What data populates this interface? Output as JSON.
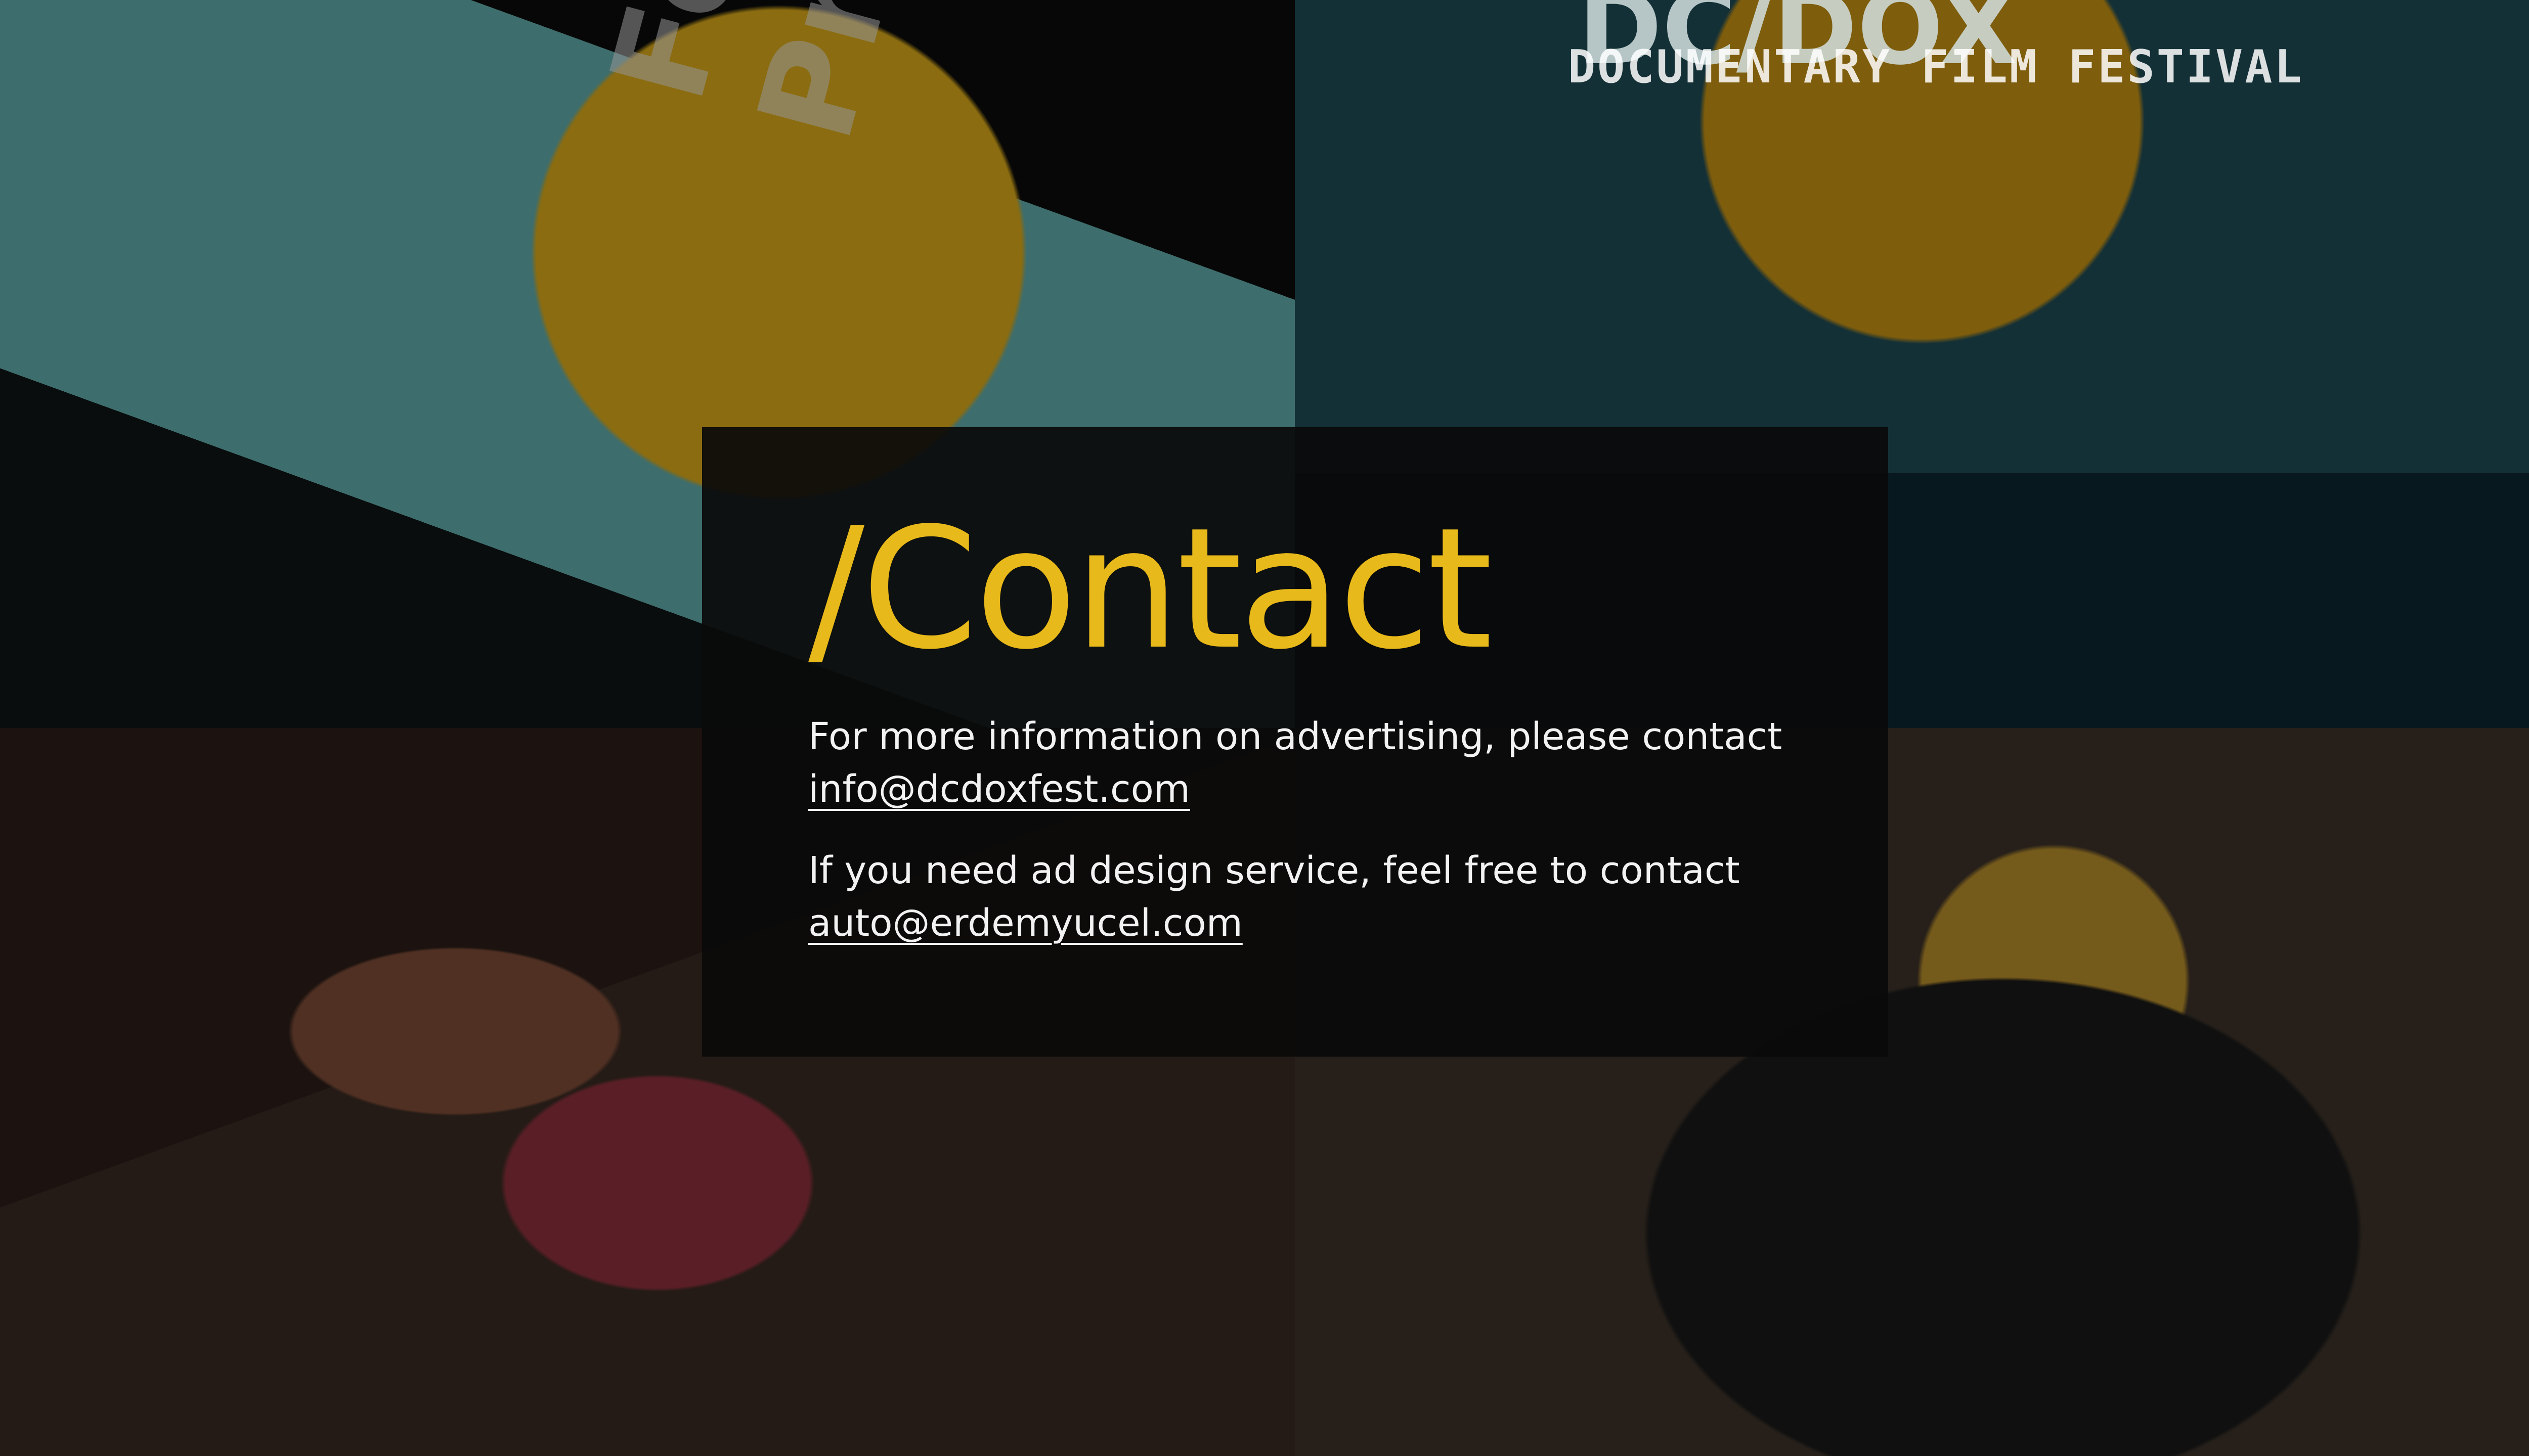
{
  "background": {
    "photos": [
      {
        "name": "festival-program-booklet"
      },
      {
        "name": "festival-stage-panel"
      },
      {
        "name": "audience-applauding"
      },
      {
        "name": "phone-recording-stage"
      }
    ],
    "poster_brand": "DC/DOX",
    "poster_subtitle": "DOCUMENTARY FILM FESTIVAL",
    "booklet_text": "Festival Program"
  },
  "panel": {
    "heading": "/Contact",
    "advertising_text": "For more information on advertising, please contact",
    "advertising_email": "info@dcdoxfest.com",
    "design_text": "If you need ad design service, feel free to contact",
    "design_email": "auto@erdemyucel.com"
  },
  "colors": {
    "accent": "#e8b91a",
    "text": "#f2f2f2",
    "panel_bg": "#0a0a0a"
  }
}
